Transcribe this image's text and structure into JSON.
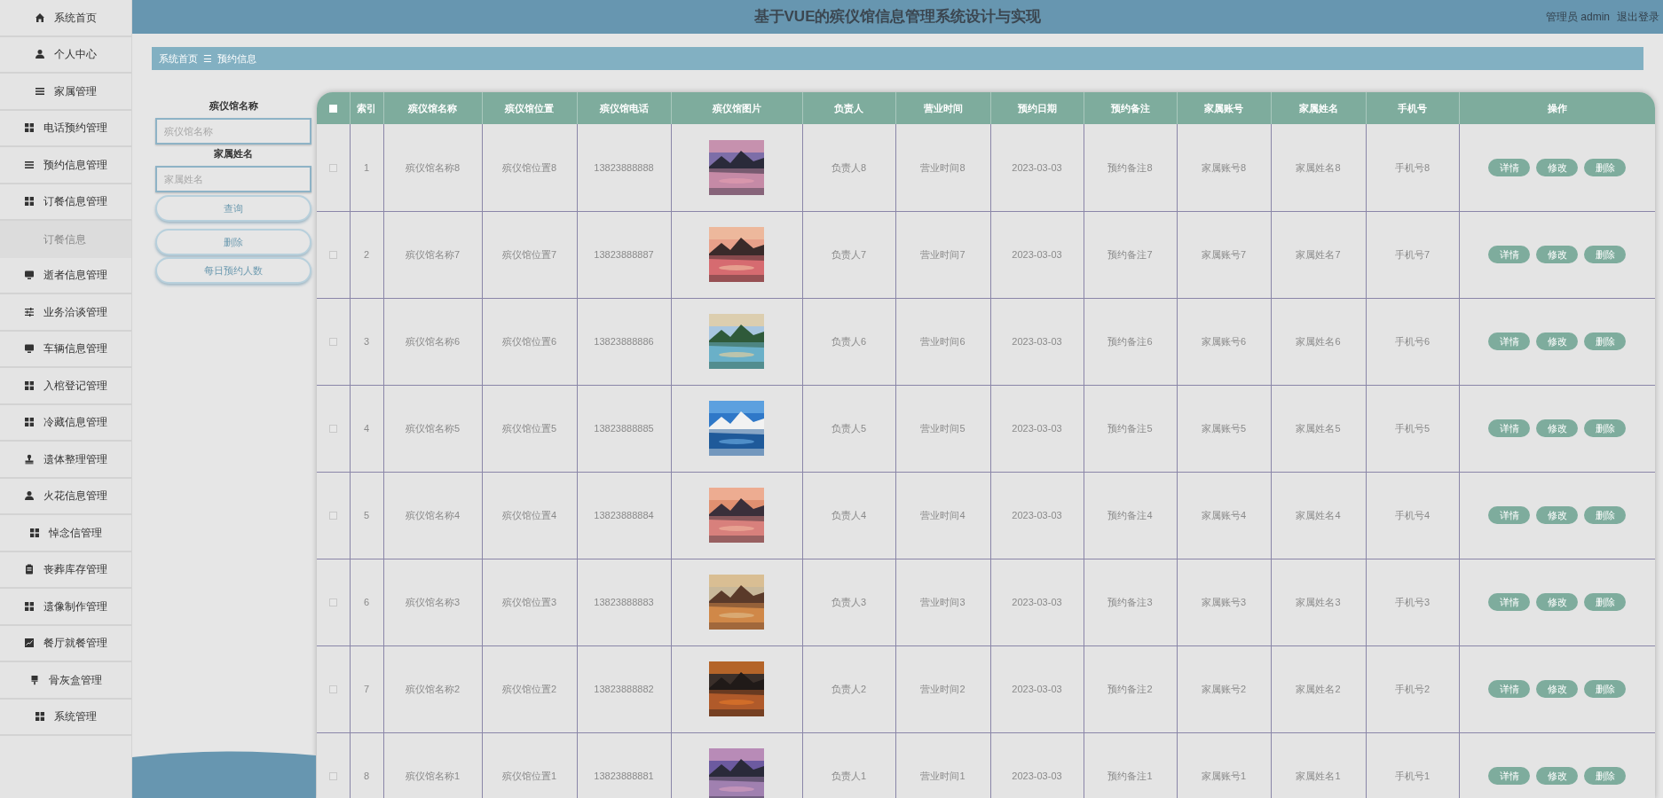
{
  "header": {
    "title": "基于VUE的殡仪馆信息管理系统设计与实现",
    "user": "管理员 admin",
    "logout": "退出登录"
  },
  "sidebar": {
    "items": [
      {
        "label": "系统首页"
      },
      {
        "label": "个人中心"
      },
      {
        "label": "家属管理"
      },
      {
        "label": "电话预约管理"
      },
      {
        "label": "预约信息管理"
      },
      {
        "label": "订餐信息管理",
        "children": [
          {
            "label": "订餐信息"
          }
        ]
      },
      {
        "label": "逝者信息管理"
      },
      {
        "label": "业务洽谈管理"
      },
      {
        "label": "车辆信息管理"
      },
      {
        "label": "入棺登记管理"
      },
      {
        "label": "冷藏信息管理"
      },
      {
        "label": "遗体整理管理"
      },
      {
        "label": "火花信息管理"
      },
      {
        "label": "悼念信管理"
      },
      {
        "label": "丧葬库存管理"
      },
      {
        "label": "遗像制作管理"
      },
      {
        "label": "餐厅就餐管理"
      },
      {
        "label": "骨灰盒管理"
      },
      {
        "label": "系统管理"
      }
    ]
  },
  "breadcrumb": {
    "home": "系统首页",
    "separator": "☰",
    "current": "预约信息"
  },
  "filters": {
    "fields": [
      {
        "label": "殡仪馆名称",
        "placeholder": "殡仪馆名称"
      },
      {
        "label": "家属姓名",
        "placeholder": "家属姓名"
      }
    ],
    "buttons": [
      "查询",
      "删除",
      "每日预约人数"
    ]
  },
  "table": {
    "select_all": {
      "checked": false
    },
    "columns": [
      "索引",
      "殡仪馆名称",
      "殡仪馆位置",
      "殡仪馆电话",
      "殡仪馆图片",
      "负责人",
      "营业时间",
      "预约日期",
      "预约备注",
      "家属账号",
      "家属姓名",
      "手机号",
      "操作"
    ],
    "rows": [
      {
        "checked": false,
        "cells": [
          "1",
          "殡仪馆名称8",
          "殡仪馆位置8",
          "13823888888",
          "",
          "负责人8",
          "营业时间8",
          "2023-03-03",
          "预约备注8",
          "家属账号8",
          "家属姓名8",
          "手机号8"
        ],
        "actions": [
          "详情",
          "修改",
          "删除"
        ]
      },
      {
        "checked": false,
        "cells": [
          "2",
          "殡仪馆名称7",
          "殡仪馆位置7",
          "13823888887",
          "",
          "负责人7",
          "营业时间7",
          "2023-03-03",
          "预约备注7",
          "家属账号7",
          "家属姓名7",
          "手机号7"
        ],
        "actions": [
          "详情",
          "修改",
          "删除"
        ]
      },
      {
        "checked": false,
        "cells": [
          "3",
          "殡仪馆名称6",
          "殡仪馆位置6",
          "13823888886",
          "",
          "负责人6",
          "营业时间6",
          "2023-03-03",
          "预约备注6",
          "家属账号6",
          "家属姓名6",
          "手机号6"
        ],
        "actions": [
          "详情",
          "修改",
          "删除"
        ]
      },
      {
        "checked": false,
        "cells": [
          "4",
          "殡仪馆名称5",
          "殡仪馆位置5",
          "13823888885",
          "",
          "负责人5",
          "营业时间5",
          "2023-03-03",
          "预约备注5",
          "家属账号5",
          "家属姓名5",
          "手机号5"
        ],
        "actions": [
          "详情",
          "修改",
          "删除"
        ]
      },
      {
        "checked": false,
        "cells": [
          "5",
          "殡仪馆名称4",
          "殡仪馆位置4",
          "13823888884",
          "",
          "负责人4",
          "营业时间4",
          "2023-03-03",
          "预约备注4",
          "家属账号4",
          "家属姓名4",
          "手机号4"
        ],
        "actions": [
          "详情",
          "修改",
          "删除"
        ]
      },
      {
        "checked": false,
        "cells": [
          "6",
          "殡仪馆名称3",
          "殡仪馆位置3",
          "13823888883",
          "",
          "负责人3",
          "营业时间3",
          "2023-03-03",
          "预约备注3",
          "家属账号3",
          "家属姓名3",
          "手机号3"
        ],
        "actions": [
          "详情",
          "修改",
          "删除"
        ]
      },
      {
        "checked": false,
        "cells": [
          "7",
          "殡仪馆名称2",
          "殡仪馆位置2",
          "13823888882",
          "",
          "负责人2",
          "营业时间2",
          "2023-03-03",
          "预约备注2",
          "家属账号2",
          "家属姓名2",
          "手机号2"
        ],
        "actions": [
          "详情",
          "修改",
          "删除"
        ]
      },
      {
        "checked": false,
        "cells": [
          "8",
          "殡仪馆名称1",
          "殡仪馆位置1",
          "13823888881",
          "",
          "负责人1",
          "营业时间1",
          "2023-03-03",
          "预约备注1",
          "家属账号1",
          "家属姓名1",
          "手机号1"
        ],
        "actions": [
          "详情",
          "修改",
          "删除"
        ]
      }
    ]
  }
}
